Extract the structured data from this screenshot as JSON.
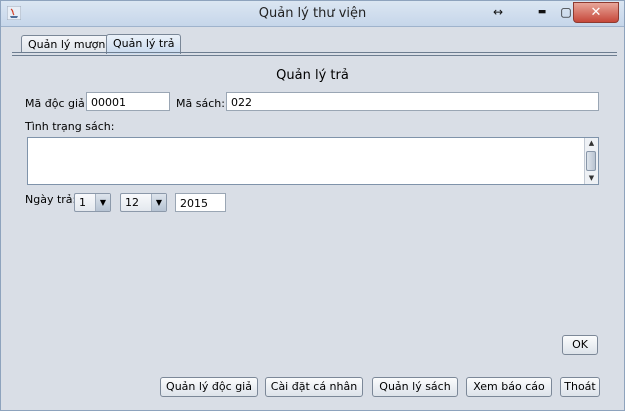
{
  "window": {
    "title": "Quản lý thư viện",
    "maximize_glyph": "↔",
    "minimize_glyph": "▬",
    "restore_glyph": "▢",
    "close_glyph": "✕"
  },
  "tabs": [
    {
      "label": "Quản lý mượn",
      "active": false
    },
    {
      "label": "Quản lý trả",
      "active": true
    }
  ],
  "form": {
    "heading": "Quản lý trả",
    "reader_id_label": "Mã độc giả:",
    "reader_id_value": "00001",
    "book_id_label": "Mã sách:",
    "book_id_value": "022",
    "condition_label": "Tình trạng sách:",
    "condition_value": "",
    "return_date_label": "Ngày trả:",
    "day_value": "1",
    "month_value": "12",
    "year_value": "2015",
    "ok_label": "OK"
  },
  "bottom_buttons": {
    "reader_mgmt": "Quản lý độc giả",
    "personal_settings": "Cài đặt cá nhân",
    "book_mgmt": "Quản lý sách",
    "view_report": "Xem báo cáo",
    "exit": "Thoát"
  },
  "colors": {
    "close_button": "#c6483a",
    "window_bg": "#d9dee6",
    "titlebar": "#c6d6ea"
  }
}
